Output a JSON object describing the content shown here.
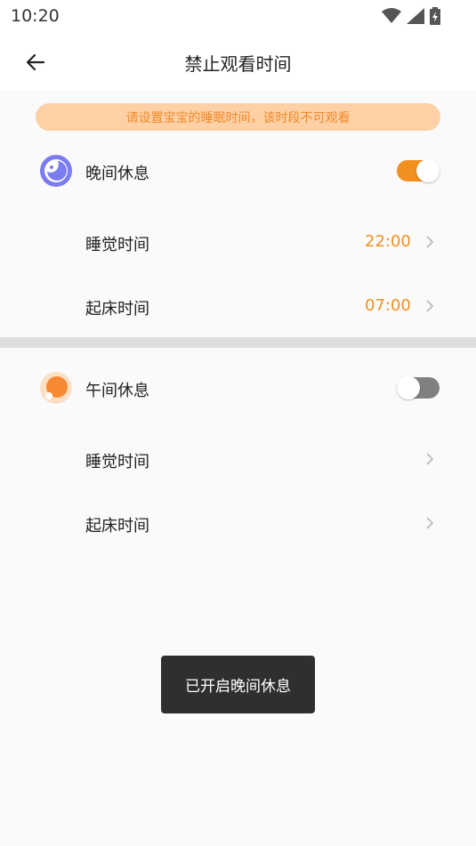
{
  "status": {
    "time": "10:20"
  },
  "header": {
    "title": "禁止观看时间"
  },
  "notice": {
    "text": "请设置宝宝的睡眠时间，该时段不可观看"
  },
  "night": {
    "title": "晚间休息",
    "enabled": true,
    "sleep_label": "睡觉时间",
    "sleep_value": "22:00",
    "wake_label": "起床时间",
    "wake_value": "07:00"
  },
  "noon": {
    "title": "午间休息",
    "enabled": false,
    "sleep_label": "睡觉时间",
    "sleep_value": "",
    "wake_label": "起床时间",
    "wake_value": ""
  },
  "toast": {
    "text": "已开启晚间休息"
  },
  "colors": {
    "accent": "#f2901f",
    "notice_bg": "#fdd0a6",
    "toggle_on": "#f2901f",
    "toggle_off": "#808080",
    "moon_icon": "#7b7cf0",
    "sun_icon": "#f58a32"
  }
}
